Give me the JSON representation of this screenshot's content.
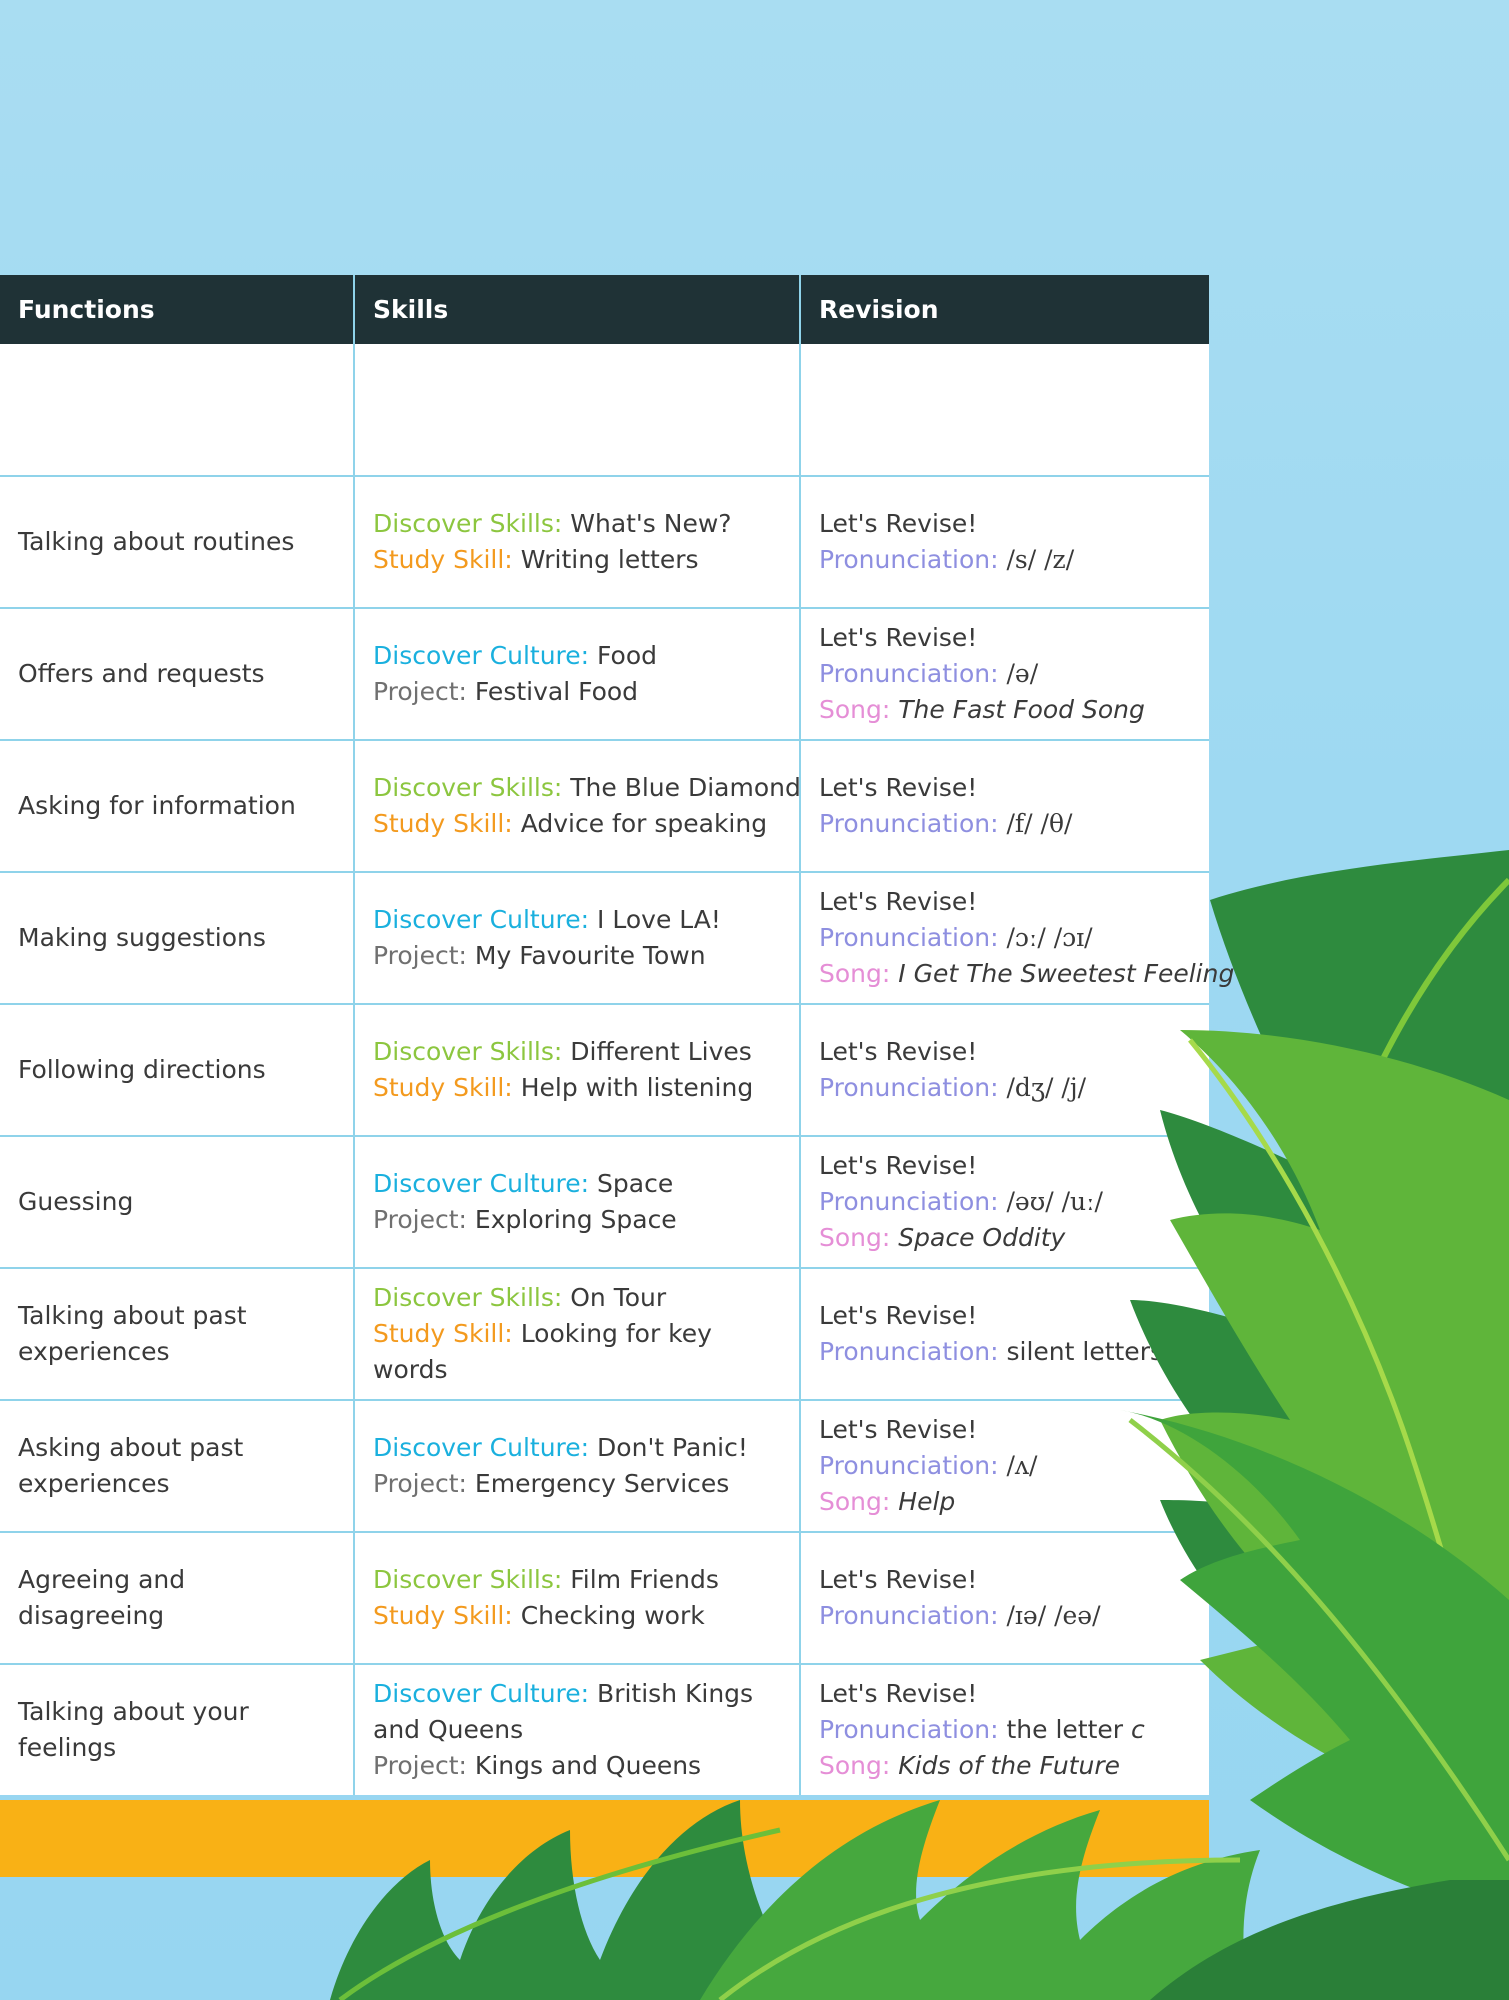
{
  "table": {
    "headers": [
      "Functions",
      "Skills",
      "Revision"
    ],
    "rows": [
      {
        "function": "Talking about routines",
        "skills": [
          {
            "label": "Discover Skills:",
            "text": "What's New?",
            "color": "green"
          },
          {
            "label": "Study Skill:",
            "text": "Writing letters",
            "color": "orange"
          }
        ],
        "revision": [
          {
            "label": "",
            "text": "Let's Revise!"
          },
          {
            "label": "Pronunciation:",
            "text": "/s/ /z/",
            "color": "purple",
            "ipa": true
          }
        ]
      },
      {
        "function": "Offers and requests",
        "skills": [
          {
            "label": "Discover Culture:",
            "text": "Food",
            "color": "blue"
          },
          {
            "label": "Project:",
            "text": "Festival Food",
            "color": "gray"
          }
        ],
        "revision": [
          {
            "label": "",
            "text": "Let's Revise!"
          },
          {
            "label": "Pronunciation:",
            "text": "/ə/",
            "color": "purple",
            "ipa": true
          },
          {
            "label": "Song:",
            "text": "The Fast Food Song",
            "color": "pink",
            "italic": true
          }
        ]
      },
      {
        "function": "Asking for information",
        "skills": [
          {
            "label": "Discover Skills:",
            "text": "The Blue Diamond",
            "color": "green"
          },
          {
            "label": "Study Skill:",
            "text": "Advice for speaking",
            "color": "orange"
          }
        ],
        "revision": [
          {
            "label": "",
            "text": "Let's Revise!"
          },
          {
            "label": "Pronunciation:",
            "text": "/f/ /θ/",
            "color": "purple",
            "ipa": true
          }
        ]
      },
      {
        "function": "Making suggestions",
        "skills": [
          {
            "label": "Discover Culture:",
            "text": "I Love LA!",
            "color": "blue"
          },
          {
            "label": "Project:",
            "text": "My Favourite Town",
            "color": "gray"
          }
        ],
        "revision": [
          {
            "label": "",
            "text": "Let's Revise!"
          },
          {
            "label": "Pronunciation:",
            "text": "/ɔː/ /ɔɪ/",
            "color": "purple",
            "ipa": true
          },
          {
            "label": "Song:",
            "text": "I Get The Sweetest Feeling",
            "color": "pink",
            "italic": true
          }
        ]
      },
      {
        "function": "Following directions",
        "skills": [
          {
            "label": "Discover Skills:",
            "text": "Different Lives",
            "color": "green"
          },
          {
            "label": "Study Skill:",
            "text": "Help with listening",
            "color": "orange"
          }
        ],
        "revision": [
          {
            "label": "",
            "text": "Let's Revise!"
          },
          {
            "label": "Pronunciation:",
            "text": "/dʒ/ /j/",
            "color": "purple",
            "ipa": true
          }
        ]
      },
      {
        "function": "Guessing",
        "skills": [
          {
            "label": "Discover Culture:",
            "text": "Space",
            "color": "blue"
          },
          {
            "label": "Project:",
            "text": "Exploring Space",
            "color": "gray"
          }
        ],
        "revision": [
          {
            "label": "",
            "text": "Let's Revise!"
          },
          {
            "label": "Pronunciation:",
            "text": "/əʊ/ /uː/",
            "color": "purple",
            "ipa": true
          },
          {
            "label": "Song:",
            "text": "Space Oddity",
            "color": "pink",
            "italic": true
          }
        ]
      },
      {
        "function": "Talking about past experiences",
        "skills": [
          {
            "label": "Discover Skills:",
            "text": "On Tour",
            "color": "green"
          },
          {
            "label": "Study Skill:",
            "text": "Looking for key words",
            "color": "orange"
          }
        ],
        "revision": [
          {
            "label": "",
            "text": "Let's Revise!"
          },
          {
            "label": "Pronunciation:",
            "text": "silent letters",
            "color": "purple"
          }
        ]
      },
      {
        "function": "Asking about past experiences",
        "skills": [
          {
            "label": "Discover Culture:",
            "text": "Don't Panic!",
            "color": "blue"
          },
          {
            "label": "Project:",
            "text": "Emergency Services",
            "color": "gray"
          }
        ],
        "revision": [
          {
            "label": "",
            "text": "Let's Revise!"
          },
          {
            "label": "Pronunciation:",
            "text": "/ʌ/",
            "color": "purple",
            "ipa": true
          },
          {
            "label": "Song:",
            "text": "Help",
            "color": "pink",
            "italic": true
          }
        ]
      },
      {
        "function": "Agreeing and disagreeing",
        "skills": [
          {
            "label": "Discover Skills:",
            "text": "Film Friends",
            "color": "green"
          },
          {
            "label": "Study Skill:",
            "text": "Checking work",
            "color": "orange"
          }
        ],
        "revision": [
          {
            "label": "",
            "text": "Let's Revise!"
          },
          {
            "label": "Pronunciation:",
            "text": "/ɪə/ /eə/",
            "color": "purple",
            "ipa": true
          }
        ]
      },
      {
        "function": "Talking about your feelings",
        "skills": [
          {
            "label": "Discover Culture:",
            "text": "British Kings and Queens",
            "color": "blue"
          },
          {
            "label": "Project:",
            "text": "Kings and Queens",
            "color": "gray"
          }
        ],
        "revision": [
          {
            "label": "",
            "text": "Let's Revise!"
          },
          {
            "label": "Pronunciation:",
            "text": "the letter c",
            "color": "purple",
            "italicTail": "c"
          },
          {
            "label": "Song:",
            "text": "Kids of the Future",
            "color": "pink",
            "italic": true
          }
        ]
      }
    ]
  },
  "colors": {
    "green": "#8cc63f",
    "orange": "#f39a1e",
    "blue": "#1ab0de",
    "purple": "#8e8fe0",
    "pink": "#e58ed6",
    "gray": "#707070",
    "header_bg": "#1f3236",
    "grid": "#8fd3ea",
    "accent_bar": "#f9b115",
    "background": "#9ed9f2",
    "leaf_dark": "#2e8b3e",
    "leaf_light": "#7ec83a"
  },
  "decor": {
    "background_leaves": "monstera-leaves-illustration",
    "ghost_heading": "faded-title-watermark"
  }
}
